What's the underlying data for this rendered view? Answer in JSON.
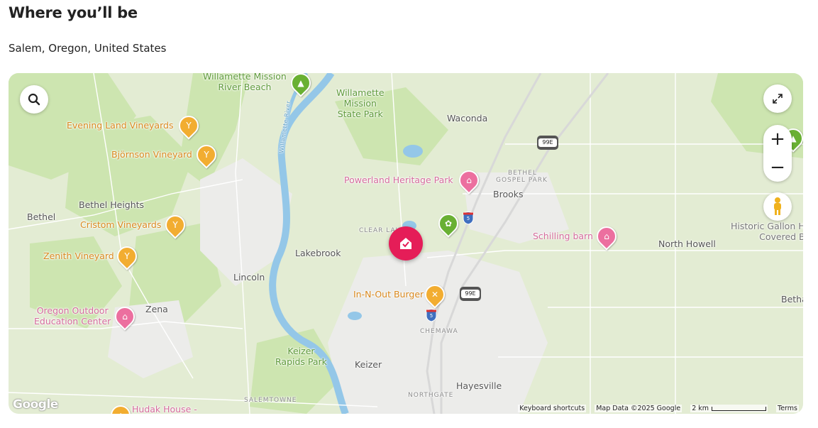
{
  "header": {
    "title": "Where you’ll be",
    "location": "Salem, Oregon, United States"
  },
  "map": {
    "colors": {
      "accent": "#E51D58",
      "land": "#E3ECD3",
      "water": "#94C7E8",
      "park": "#C6E3A8",
      "urban": "#EEEEEE"
    },
    "places": {
      "waconda": "Waconda",
      "brooks": "Brooks",
      "bethel_heights": "Bethel Heights",
      "bethel": "Bethel",
      "lakebrook": "Lakebrook",
      "lincoln": "Lincoln",
      "zena": "Zena",
      "keizer": "Keizer",
      "hayesville": "Hayesville",
      "north_howell": "North Howell",
      "betha": "Betha",
      "clear_lake": "CLEAR LAKE",
      "bethel_gospel_park_1": "BETHEL",
      "bethel_gospel_park_2": "GOSPEL PARK",
      "chemawa": "CHEMAWA",
      "northgate": "NORTHGATE",
      "salemtowne": "SALEMTOWNE",
      "willamette_river": "Willamette River"
    },
    "pois": {
      "wm_river_beach_1": "Willamette Mission",
      "wm_river_beach_2": "River Beach",
      "wm_state_park_1": "Willamette",
      "wm_state_park_2": "Mission",
      "wm_state_park_3": "State Park",
      "evening_land": "Evening Land Vineyards",
      "bjornson": "Björnson Vineyard",
      "cristom": "Cristom Vineyards",
      "zenith": "Zenith Vineyard",
      "powerland": "Powerland Heritage Park",
      "schilling": "Schilling barn",
      "in_n_out": "In-N-Out Burger",
      "oregon_outdoor_1": "Oregon Outdoor",
      "oregon_outdoor_2": "Education Center",
      "keizer_rapids_1": "Keizer",
      "keizer_rapids_2": "Rapids Park",
      "historic_gallon_1": "Historic Gallon H",
      "historic_gallon_2": "Covered B",
      "hudak": "Hudak House -"
    },
    "shields": {
      "hwy_99e": "99E",
      "i5": "5"
    },
    "controls": {
      "search_icon": "search-icon",
      "fullscreen_icon": "expand-icon",
      "zoom_in": "+",
      "zoom_out": "−",
      "pegman_icon": "street-view-icon"
    },
    "footer": {
      "logo": "Google",
      "shortcuts": "Keyboard shortcuts",
      "map_data": "Map Data ©2025 Google",
      "scale": "2 km",
      "terms": "Terms"
    }
  }
}
